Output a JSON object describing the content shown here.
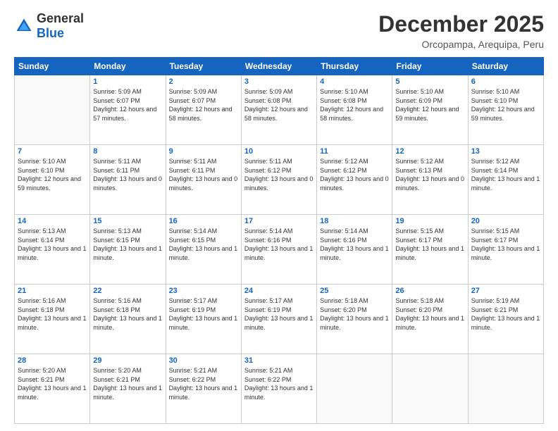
{
  "header": {
    "logo": {
      "general": "General",
      "blue": "Blue"
    },
    "month": "December 2025",
    "location": "Orcopampa, Arequipa, Peru"
  },
  "weekdays": [
    "Sunday",
    "Monday",
    "Tuesday",
    "Wednesday",
    "Thursday",
    "Friday",
    "Saturday"
  ],
  "weeks": [
    [
      {
        "day": "",
        "empty": true
      },
      {
        "day": "1",
        "sunrise": "5:09 AM",
        "sunset": "6:07 PM",
        "daylight": "12 hours and 57 minutes."
      },
      {
        "day": "2",
        "sunrise": "5:09 AM",
        "sunset": "6:07 PM",
        "daylight": "12 hours and 58 minutes."
      },
      {
        "day": "3",
        "sunrise": "5:09 AM",
        "sunset": "6:08 PM",
        "daylight": "12 hours and 58 minutes."
      },
      {
        "day": "4",
        "sunrise": "5:10 AM",
        "sunset": "6:08 PM",
        "daylight": "12 hours and 58 minutes."
      },
      {
        "day": "5",
        "sunrise": "5:10 AM",
        "sunset": "6:09 PM",
        "daylight": "12 hours and 59 minutes."
      },
      {
        "day": "6",
        "sunrise": "5:10 AM",
        "sunset": "6:10 PM",
        "daylight": "12 hours and 59 minutes."
      }
    ],
    [
      {
        "day": "7",
        "sunrise": "5:10 AM",
        "sunset": "6:10 PM",
        "daylight": "12 hours and 59 minutes."
      },
      {
        "day": "8",
        "sunrise": "5:11 AM",
        "sunset": "6:11 PM",
        "daylight": "13 hours and 0 minutes."
      },
      {
        "day": "9",
        "sunrise": "5:11 AM",
        "sunset": "6:11 PM",
        "daylight": "13 hours and 0 minutes."
      },
      {
        "day": "10",
        "sunrise": "5:11 AM",
        "sunset": "6:12 PM",
        "daylight": "13 hours and 0 minutes."
      },
      {
        "day": "11",
        "sunrise": "5:12 AM",
        "sunset": "6:12 PM",
        "daylight": "13 hours and 0 minutes."
      },
      {
        "day": "12",
        "sunrise": "5:12 AM",
        "sunset": "6:13 PM",
        "daylight": "13 hours and 0 minutes."
      },
      {
        "day": "13",
        "sunrise": "5:12 AM",
        "sunset": "6:14 PM",
        "daylight": "13 hours and 1 minute."
      }
    ],
    [
      {
        "day": "14",
        "sunrise": "5:13 AM",
        "sunset": "6:14 PM",
        "daylight": "13 hours and 1 minute."
      },
      {
        "day": "15",
        "sunrise": "5:13 AM",
        "sunset": "6:15 PM",
        "daylight": "13 hours and 1 minute."
      },
      {
        "day": "16",
        "sunrise": "5:14 AM",
        "sunset": "6:15 PM",
        "daylight": "13 hours and 1 minute."
      },
      {
        "day": "17",
        "sunrise": "5:14 AM",
        "sunset": "6:16 PM",
        "daylight": "13 hours and 1 minute."
      },
      {
        "day": "18",
        "sunrise": "5:14 AM",
        "sunset": "6:16 PM",
        "daylight": "13 hours and 1 minute."
      },
      {
        "day": "19",
        "sunrise": "5:15 AM",
        "sunset": "6:17 PM",
        "daylight": "13 hours and 1 minute."
      },
      {
        "day": "20",
        "sunrise": "5:15 AM",
        "sunset": "6:17 PM",
        "daylight": "13 hours and 1 minute."
      }
    ],
    [
      {
        "day": "21",
        "sunrise": "5:16 AM",
        "sunset": "6:18 PM",
        "daylight": "13 hours and 1 minute."
      },
      {
        "day": "22",
        "sunrise": "5:16 AM",
        "sunset": "6:18 PM",
        "daylight": "13 hours and 1 minute."
      },
      {
        "day": "23",
        "sunrise": "5:17 AM",
        "sunset": "6:19 PM",
        "daylight": "13 hours and 1 minute."
      },
      {
        "day": "24",
        "sunrise": "5:17 AM",
        "sunset": "6:19 PM",
        "daylight": "13 hours and 1 minute."
      },
      {
        "day": "25",
        "sunrise": "5:18 AM",
        "sunset": "6:20 PM",
        "daylight": "13 hours and 1 minute."
      },
      {
        "day": "26",
        "sunrise": "5:18 AM",
        "sunset": "6:20 PM",
        "daylight": "13 hours and 1 minute."
      },
      {
        "day": "27",
        "sunrise": "5:19 AM",
        "sunset": "6:21 PM",
        "daylight": "13 hours and 1 minute."
      }
    ],
    [
      {
        "day": "28",
        "sunrise": "5:20 AM",
        "sunset": "6:21 PM",
        "daylight": "13 hours and 1 minute."
      },
      {
        "day": "29",
        "sunrise": "5:20 AM",
        "sunset": "6:21 PM",
        "daylight": "13 hours and 1 minute."
      },
      {
        "day": "30",
        "sunrise": "5:21 AM",
        "sunset": "6:22 PM",
        "daylight": "13 hours and 1 minute."
      },
      {
        "day": "31",
        "sunrise": "5:21 AM",
        "sunset": "6:22 PM",
        "daylight": "13 hours and 1 minute."
      },
      {
        "day": "",
        "empty": true
      },
      {
        "day": "",
        "empty": true
      },
      {
        "day": "",
        "empty": true
      }
    ]
  ]
}
